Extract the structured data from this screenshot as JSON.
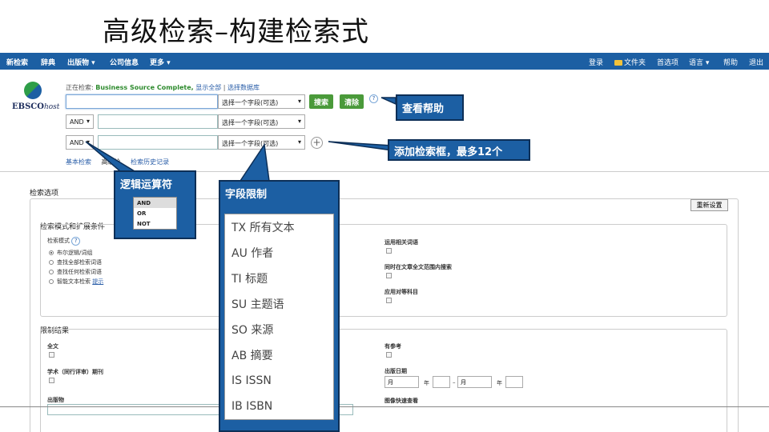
{
  "slide_title": "高级检索–构建检索式",
  "nav": {
    "left": [
      "新检索",
      "辞典",
      "出版物 ▾",
      "公司信息",
      "更多 ▾"
    ],
    "right": [
      "登录",
      "文件夹",
      "首选项",
      "语言 ▾",
      "帮助",
      "退出"
    ]
  },
  "logo": {
    "brand": "EBSCO",
    "suffix": "host"
  },
  "searching": {
    "prefix": "正在检索:",
    "database": "Business Source Complete,",
    "show_all": "显示全部",
    "choose_db": "选择数据库"
  },
  "rows": [
    {
      "field": "选择一个字段(可选)"
    },
    {
      "op": "AND",
      "field": "选择一个字段(可选)"
    },
    {
      "op": "AND",
      "field": "选择一个字段(可选)"
    }
  ],
  "buttons": {
    "search": "搜索",
    "clear": "清除",
    "help": "?",
    "add": "+"
  },
  "links": [
    "基本检索",
    "高级检",
    "检索历史记录"
  ],
  "options": {
    "title": "检索选项",
    "reset": "重新设置",
    "modes_title": "检索模式和扩展条件",
    "mode_label": "检索模式",
    "modes": [
      "布尔逻辑/词组",
      "查找全部检索词语",
      "查找任何检索词语",
      "智能文本检索"
    ],
    "smart_hint": "提示",
    "expanders": [
      "运用相关词语",
      "同时在文章全文范围内搜索",
      "应用对等科目"
    ]
  },
  "limits": {
    "title": "限制结果",
    "fulltext": "全文",
    "scholarly": "学术（同行评审）期刊",
    "publication": "出版物",
    "references": "有参考",
    "pubdate": "出版日期",
    "month1": "月",
    "month2": "月",
    "year": "年",
    "dash": "–",
    "image_quick": "图像快速查看"
  },
  "callouts": {
    "help": "查看帮助",
    "add_box": "添加检索框，最多12个",
    "logic": "逻辑运算符",
    "logic_options": [
      "AND",
      "OR",
      "NOT"
    ],
    "field": "字段限制",
    "field_options": [
      "TX 所有文本",
      "AU 作者",
      "TI 标题",
      "SU 主题语",
      "SO 来源",
      "AB 摘要",
      "IS ISSN",
      "IB ISBN"
    ]
  },
  "colors": {
    "nav_blue": "#1c5fa3",
    "callout_border": "#0d2f57",
    "green_button": "#4a9a3a"
  }
}
